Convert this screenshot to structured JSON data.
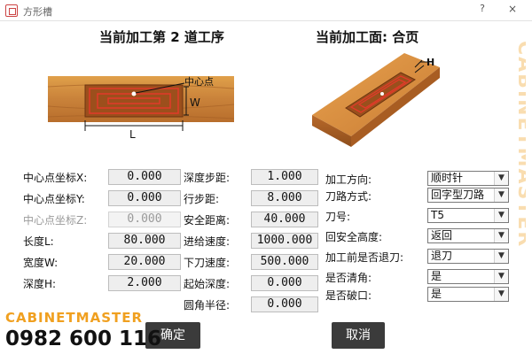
{
  "window": {
    "title": "方形槽",
    "help": "?",
    "close": "×"
  },
  "headers": {
    "current_step": "当前加工第 2 道工序",
    "current_face": "当前加工面: 合页"
  },
  "diagram_left": {
    "center_label": "中心点",
    "w_label": "W",
    "l_label": "L"
  },
  "diagram_right": {
    "h_label": "H"
  },
  "col1": {
    "center_x": {
      "label": "中心点坐标X:",
      "value": "0.000"
    },
    "center_y": {
      "label": "中心点坐标Y:",
      "value": "0.000"
    },
    "center_z": {
      "label": "中心点坐标Z:",
      "value": "0.000"
    },
    "length": {
      "label": "长度L:",
      "value": "80.000"
    },
    "width": {
      "label": "宽度W:",
      "value": "20.000"
    },
    "depth": {
      "label": "深度H:",
      "value": "2.000"
    }
  },
  "col2": {
    "depth_step": {
      "label": "深度步距:",
      "value": "1.000"
    },
    "row_step": {
      "label": "行步距:",
      "value": "8.000"
    },
    "safe_distance": {
      "label": "安全距离:",
      "value": "40.000"
    },
    "feed_speed": {
      "label": "进给速度:",
      "value": "1000.000"
    },
    "plunge_speed": {
      "label": "下刀速度:",
      "value": "500.000"
    },
    "start_depth": {
      "label": "起始深度:",
      "value": "0.000"
    },
    "corner_radius": {
      "label": "圆角半径:",
      "value": "0.000"
    }
  },
  "col3": {
    "direction": {
      "label": "加工方向:",
      "value": "顺时针"
    },
    "tool_path": {
      "label": "刀路方式:",
      "value": "回字型刀路"
    },
    "tool_number": {
      "label": "刀号:",
      "value": "T5"
    },
    "return_height": {
      "label": "回安全高度:",
      "value": "返回"
    },
    "retract": {
      "label": "加工前是否退刀:",
      "value": "退刀"
    },
    "clear_corner": {
      "label": "是否清角:",
      "value": "是"
    },
    "break_edge": {
      "label": "是否破口:",
      "value": "是"
    }
  },
  "buttons": {
    "ok": "确定",
    "cancel": "取消"
  },
  "watermark": {
    "vertical": "CABINETMASTER",
    "brand": "CABINETMASTER",
    "phone": "0982 600 116"
  },
  "icons": {
    "app": "window-app-icon",
    "dropdown": "chevron-down-icon"
  },
  "colors": {
    "button_bg": "#3b3b3b",
    "brand_orange": "#f0a020",
    "wood": "#d18a3a"
  }
}
